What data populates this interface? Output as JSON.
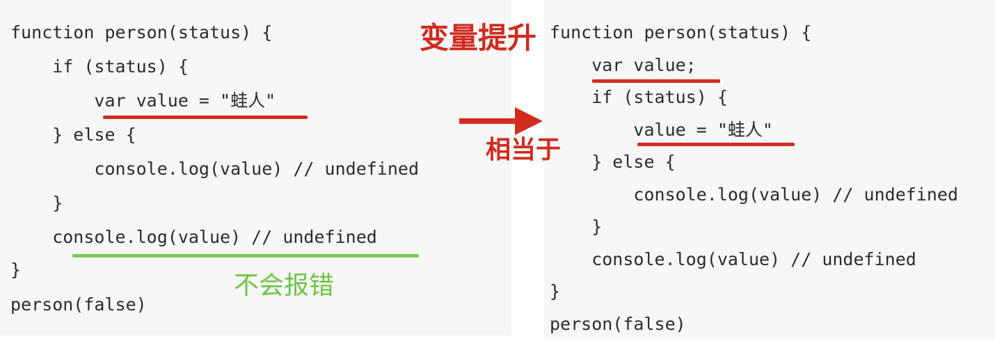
{
  "annotations": {
    "title": "变量提升",
    "equivalent": "相当于",
    "no_error": "不会报错"
  },
  "left_code": [
    "function person(status) {",
    "    if (status) {",
    "        var value = \"蛙人\"",
    "    } else {",
    "        console.log(value) // undefined",
    "    }",
    "    console.log(value) // undefined",
    "}",
    "person(false)"
  ],
  "right_code": [
    "function person(status) {",
    "    var value;",
    "    if (status) {",
    "        value = \"蛙人\"",
    "    } else {",
    "        console.log(value) // undefined",
    "    }",
    "    console.log(value) // undefined",
    "}",
    "person(false)"
  ],
  "colors": {
    "red_highlight": "#cf2b1f",
    "green_highlight": "#7bcc52",
    "code_text": "#2b2b2b",
    "panel_bg": "#f7f7f7"
  }
}
